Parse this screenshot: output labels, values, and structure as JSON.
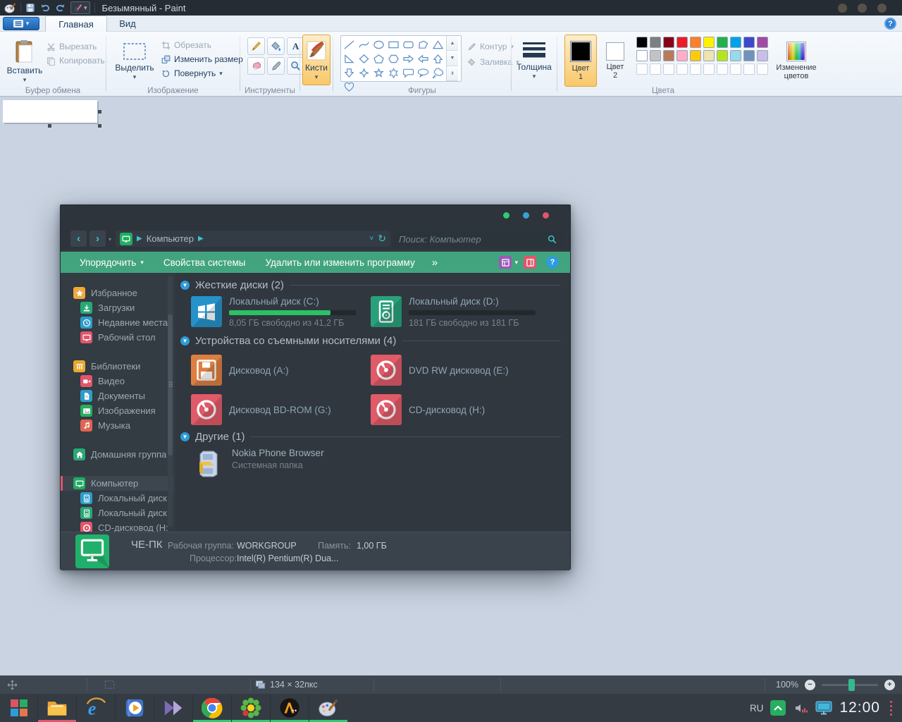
{
  "paint": {
    "title": "Безымянный - Paint",
    "tabs": {
      "home": "Главная",
      "view": "Вид"
    },
    "clipboard": {
      "label": "Буфер обмена",
      "paste": "Вставить",
      "cut": "Вырезать",
      "copy": "Копировать"
    },
    "image": {
      "label": "Изображение",
      "select": "Выделить",
      "crop": "Обрезать",
      "resize": "Изменить размер",
      "rotate": "Повернуть"
    },
    "tools": {
      "label": "Инструменты"
    },
    "brushes": {
      "label": "Кисти"
    },
    "shapes": {
      "label": "Фигуры",
      "outline": "Контур",
      "fill": "Заливка"
    },
    "size": {
      "label": "Толщина"
    },
    "colors": {
      "label": "Цвета",
      "color1_line1": "Цвет",
      "color1_line2": "1",
      "color2_line1": "Цвет",
      "color2_line2": "2",
      "edit_line1": "Изменение",
      "edit_line2": "цветов",
      "color1_value": "#000000",
      "color2_value": "#ffffff",
      "palette_row1": [
        "#000000",
        "#7f7f7f",
        "#880015",
        "#ed1c24",
        "#ff7f27",
        "#fff200",
        "#22b14c",
        "#00a2e8",
        "#3f48cc",
        "#a349a4"
      ],
      "palette_row2": [
        "#ffffff",
        "#c3c3c3",
        "#b97a57",
        "#ffaec9",
        "#ffc90e",
        "#efe4b0",
        "#b5e61d",
        "#99d9ea",
        "#7092be",
        "#c8bfe7"
      ]
    },
    "statusbar": {
      "dimensions": "134 × 32пкс",
      "zoom": "100%"
    }
  },
  "explorer": {
    "window_dots": [
      "#2ecc71",
      "#38a3d8",
      "#e0566a"
    ],
    "breadcrumb": "Компьютер",
    "search_placeholder": "Поиск: Компьютер",
    "toolbar": {
      "organize": "Упорядочить",
      "system_props": "Свойства системы",
      "uninstall": "Удалить или изменить программу",
      "more": "»"
    },
    "sidebar": [
      {
        "label": "Избранное",
        "icon": "star",
        "color": "#f1a83b",
        "indent": 0
      },
      {
        "label": "Загрузки",
        "icon": "download",
        "color": "#2aa876",
        "indent": 1
      },
      {
        "label": "Недавние места",
        "icon": "clock",
        "color": "#2e9dc9",
        "indent": 1
      },
      {
        "label": "Рабочий стол",
        "icon": "monitor",
        "color": "#e0566a",
        "indent": 1
      },
      {
        "label": "Библиотеки",
        "icon": "library",
        "color": "#eba72e",
        "indent": 0,
        "gap": true
      },
      {
        "label": "Видео",
        "icon": "video",
        "color": "#e0566a",
        "indent": 1
      },
      {
        "label": "Документы",
        "icon": "document",
        "color": "#2e9dc9",
        "indent": 1
      },
      {
        "label": "Изображения",
        "icon": "image",
        "color": "#27ae60",
        "indent": 1
      },
      {
        "label": "Музыка",
        "icon": "music",
        "color": "#e06552",
        "indent": 1
      },
      {
        "label": "Домашняя группа",
        "icon": "home",
        "color": "#2aa876",
        "indent": 0,
        "gap": true
      },
      {
        "label": "Компьютер",
        "icon": "monitor",
        "color": "#1fae63",
        "indent": 0,
        "gap": true,
        "selected": true
      },
      {
        "label": "Локальный диск",
        "icon": "disk",
        "color": "#2e9dc9",
        "indent": 1
      },
      {
        "label": "Локальный диск",
        "icon": "disk",
        "color": "#2aa876",
        "indent": 1
      },
      {
        "label": "CD-дисковод (H:",
        "icon": "disc",
        "color": "#e0566a",
        "indent": 1
      }
    ],
    "sections": {
      "hdd": {
        "title": "Жесткие диски (2)",
        "c": {
          "name": "Локальный диск (C:)",
          "info": "8,05 ГБ свободно из 41,2 ГБ",
          "fill_pct": 80,
          "icon_color": "#2592c9"
        },
        "d": {
          "name": "Локальный диск (D:)",
          "info": "181 ГБ свободно из 181 ГБ",
          "fill_pct": 0,
          "icon_color": "#28a17b"
        }
      },
      "removable": {
        "title": "Устройства со съемными носителями (4)",
        "a": {
          "name": "Дисковод (A:)",
          "icon_color": "#dd7f42"
        },
        "e": {
          "name": "DVD RW дисковод (E:)",
          "icon_color": "#e05a68"
        },
        "g": {
          "name": "Дисковод BD-ROM (G:)",
          "icon_color": "#e05a68"
        },
        "h": {
          "name": "CD-дисковод (H:)",
          "icon_color": "#e05a68"
        }
      },
      "other": {
        "title": "Другие (1)",
        "nokia": {
          "name": "Nokia Phone Browser",
          "info": "Системная папка"
        }
      }
    },
    "details": {
      "pc_name": "ЧЕ-ПК",
      "workgroup_label": "Рабочая группа:",
      "workgroup": "WORKGROUP",
      "memory_label": "Память:",
      "memory": "1,00 ГБ",
      "cpu_label": "Процессор:",
      "cpu": "Intel(R) Pentium(R) Dua..."
    }
  },
  "taskbar": {
    "lang": "RU",
    "time": "12:00",
    "start_colors": [
      "#db5461",
      "#27ae60",
      "#2d9cdb",
      "#e2774d"
    ],
    "apps": [
      {
        "name": "explorer",
        "indicator": "#e0566a"
      },
      {
        "name": "ie"
      },
      {
        "name": "wmp"
      },
      {
        "name": "kmplayer"
      },
      {
        "name": "chrome",
        "indicator": "#2ecc71"
      },
      {
        "name": "icq",
        "indicator": "#2ecc71"
      },
      {
        "name": "aimp",
        "indicator": "#2ecc71"
      },
      {
        "name": "paint",
        "indicator": "#2ecc71"
      }
    ]
  }
}
